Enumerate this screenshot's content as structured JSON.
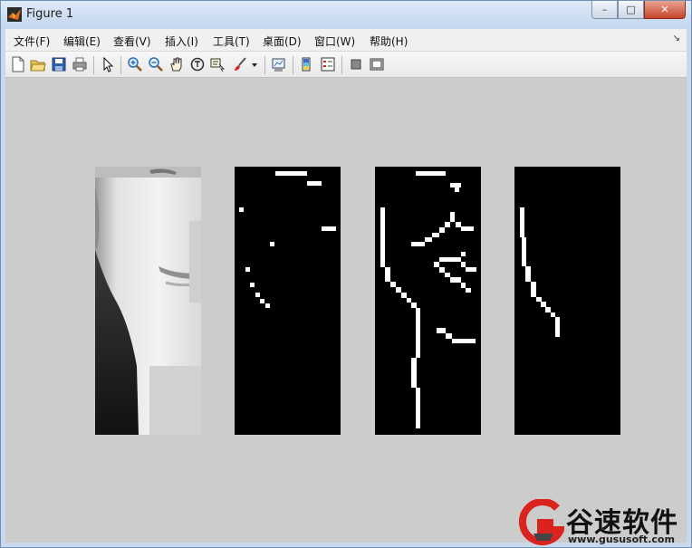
{
  "window": {
    "title": "Figure 1"
  },
  "caption_buttons": {
    "minimize": "–",
    "maximize": "□",
    "close": "✕"
  },
  "menu": [
    {
      "label": "文件(F)"
    },
    {
      "label": "编辑(E)"
    },
    {
      "label": "查看(V)"
    },
    {
      "label": "插入(I)"
    },
    {
      "label": "工具(T)"
    },
    {
      "label": "桌面(D)"
    },
    {
      "label": "窗口(W)"
    },
    {
      "label": "帮助(H)"
    }
  ],
  "menu_overflow": "↘",
  "toolbar_icons": [
    "new-figure-icon",
    "open-file-icon",
    "save-icon",
    "print-icon",
    "edit-plot-arrow-icon",
    "zoom-in-icon",
    "zoom-out-icon",
    "pan-hand-icon",
    "rotate-3d-icon",
    "data-cursor-icon",
    "brush-icon",
    "brush-dropdown-icon",
    "link-plot-icon",
    "insert-colorbar-icon",
    "insert-legend-icon",
    "hide-plot-tools-icon",
    "show-plot-tools-icon"
  ],
  "panels": [
    {
      "name": "grayscale-face-image"
    },
    {
      "name": "edge-map-1"
    },
    {
      "name": "edge-map-2"
    },
    {
      "name": "edge-map-3"
    }
  ],
  "watermark": {
    "title": "谷速软件",
    "url": "www.gususoft.com"
  },
  "colors": {
    "plot_bg": "#cccccc",
    "titlebar": "#c8d9ee",
    "menu_bg": "#f0f0f0",
    "logo_red": "#d9231c"
  }
}
